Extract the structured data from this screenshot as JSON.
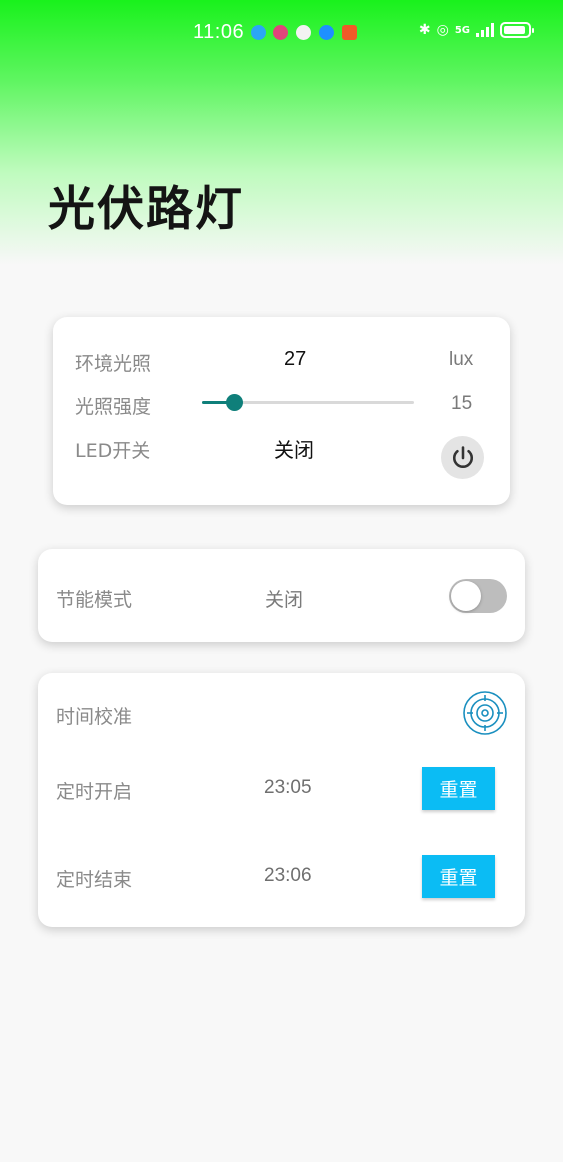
{
  "status_bar": {
    "time": "11:06",
    "network_label": "5G",
    "battery_level": 0.9
  },
  "page_title": "光伏路灯",
  "sensor_card": {
    "ambient_light_label": "环境光照",
    "ambient_light_value": "27",
    "ambient_light_unit": "lux",
    "intensity_label": "光照强度",
    "intensity_value": "15",
    "intensity_fraction": 0.15,
    "led_label": "LED开关",
    "led_state": "关闭",
    "power_icon": "power-icon"
  },
  "eco_card": {
    "label": "节能模式",
    "state": "关闭",
    "toggle_on": false
  },
  "timer_card": {
    "calibrate_label": "时间校准",
    "calibrate_icon": "crosshair-target-icon",
    "start_label": "定时开启",
    "start_time": "23:05",
    "end_label": "定时结束",
    "end_time": "23:06",
    "reset_label": "重置"
  },
  "colors": {
    "accent": "#0f7f7a",
    "button": "#0bbcf4",
    "header_green": "#19f21c"
  }
}
